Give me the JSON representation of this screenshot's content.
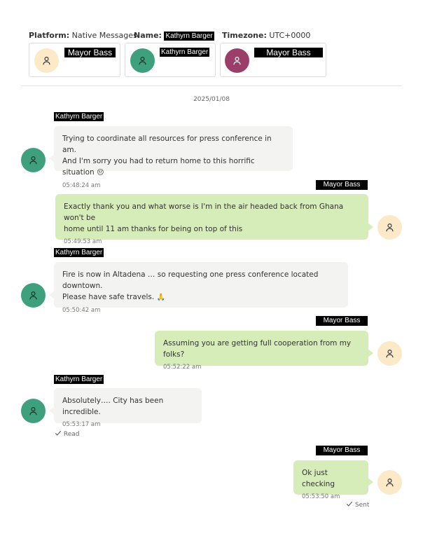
{
  "header": {
    "platform_label": "Platform:",
    "platform_value": "Native Messages",
    "name_label": "Name:",
    "name_value": "Kathyrn Barger",
    "timezone_label": "Timezone:",
    "timezone_value": "UTC+0000"
  },
  "participants": [
    {
      "name": "Mayor Bass",
      "avatar_color": "#fbe9c8",
      "icon": "person-icon"
    },
    {
      "name": "Kathyrn Barger",
      "avatar_color": "#3ea07c",
      "icon": "person-icon"
    },
    {
      "name": "Mayor Bass",
      "avatar_color": "#9b3f6a",
      "icon": "person-icon"
    }
  ],
  "date": "2025/01/08",
  "messages": [
    {
      "sender": "Kathyrn Barger",
      "direction": "incoming",
      "line1": "Trying to coordinate all resources for press conference in am.",
      "line2": "And I'm sorry you had to return home to this horrific situation",
      "emoji": "😔",
      "time": "05:48:24 am"
    },
    {
      "sender": "Mayor Bass",
      "direction": "outgoing",
      "line1": "Exactly thank you and what worse is I'm in the air headed back from Ghana won't be",
      "line2": "home until 11 am thanks for being on top of this",
      "time": "05:49:53 am"
    },
    {
      "sender": "Kathyrn Barger",
      "direction": "incoming",
      "line1": "Fire is now in Altadena … so requesting one press conference located downtown.",
      "line2": "Please have safe travels.",
      "emoji": "🙏",
      "time": "05:50:42 am"
    },
    {
      "sender": "Mayor Bass",
      "direction": "outgoing",
      "line1": "Assuming you are getting full cooperation from my folks?",
      "time": "05:52:22 am"
    },
    {
      "sender": "Kathyrn Barger",
      "direction": "incoming",
      "line1": "Absolutely…. City has been incredible.",
      "time": "05:53:17 am",
      "status": "Read"
    },
    {
      "sender": "Mayor Bass",
      "direction": "outgoing",
      "line1": "Ok just checking",
      "time": "05:53:50 am",
      "status": "Sent"
    }
  ],
  "colors": {
    "incoming_bubble": "#f3f3f1",
    "outgoing_bubble": "#d6ecb9",
    "redaction": "#000000"
  }
}
